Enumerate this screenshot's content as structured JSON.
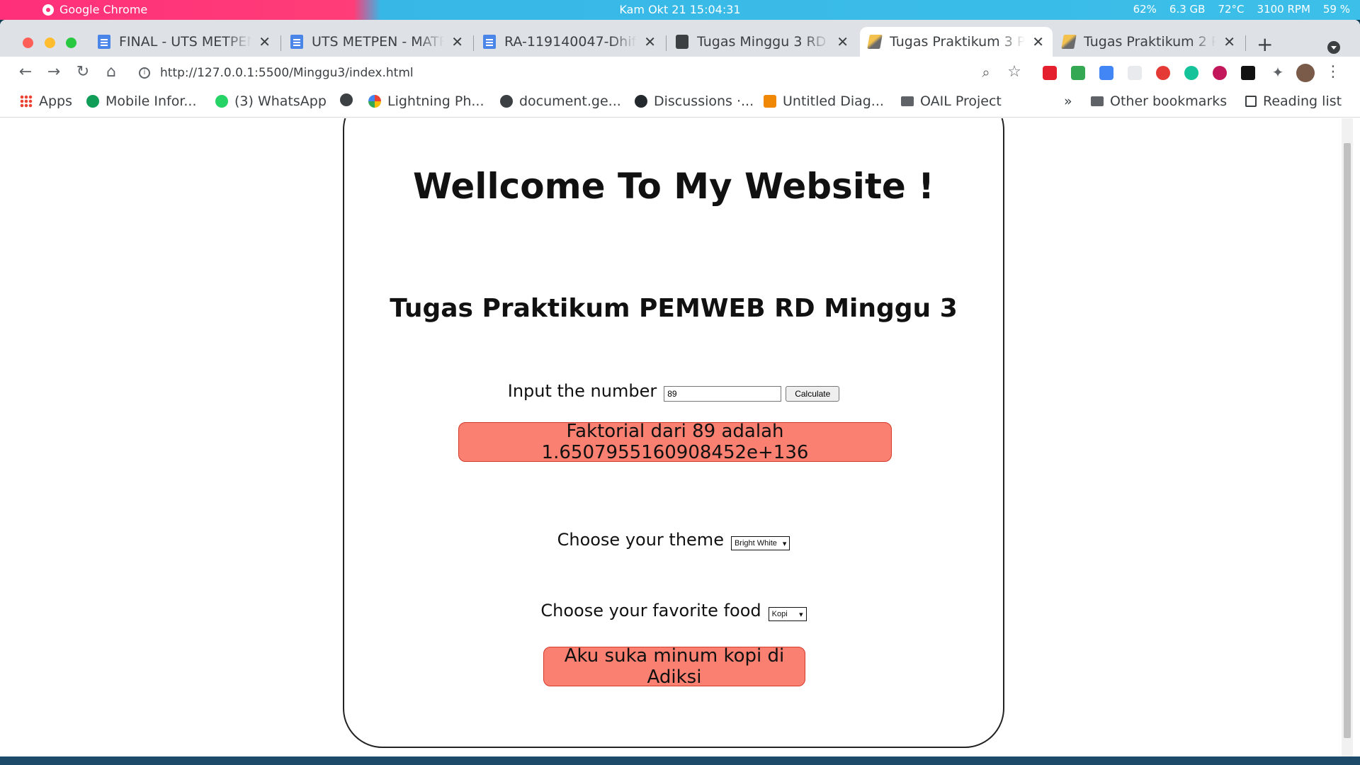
{
  "topbar": {
    "app_name": "Google Chrome",
    "clock": "Kam Okt 21  15:04:31",
    "stats": [
      "62%",
      "6.3 GB",
      "72°C",
      "3100 RPM",
      "59 %"
    ]
  },
  "tabs": [
    {
      "label": "FINAL - UTS METPEN",
      "icon": "doc"
    },
    {
      "label": "UTS METPEN - MATRI",
      "icon": "doc"
    },
    {
      "label": "RA-119140047-Dhifa",
      "icon": "doc"
    },
    {
      "label": "Tugas Minggu 3 RD",
      "icon": "pic"
    },
    {
      "label": "Tugas Praktikum 3 PE",
      "icon": "pen"
    },
    {
      "label": "Tugas Praktikum 2 PE",
      "icon": "pen"
    }
  ],
  "toolbar": {
    "url": "http://127.0.0.1:5500/Minggu3/index.html"
  },
  "bookmarks": {
    "items": [
      "Apps",
      "Mobile Infor...",
      "(3) WhatsApp",
      "Lightning Ph...",
      "document.ge...",
      "Discussions ·...",
      "Untitled Diag...",
      "OAIL Project"
    ],
    "overflow": "»",
    "other": "Other bookmarks",
    "reading": "Reading list"
  },
  "page": {
    "title": "Wellcome To My Website !",
    "subtitle": "Tugas Praktikum PEMWEB RD Minggu 3",
    "input_label": "Input the number",
    "input_value": "89",
    "calc_label": "Calculate",
    "fact_result": "Faktorial dari 89 adalah 1.6507955160908452e+136",
    "theme_label": "Choose your theme",
    "theme_value": "Bright White",
    "food_label": "Choose your favorite food",
    "food_value": "Kopi",
    "food_result": "Aku suka minum kopi di Adiksi"
  }
}
